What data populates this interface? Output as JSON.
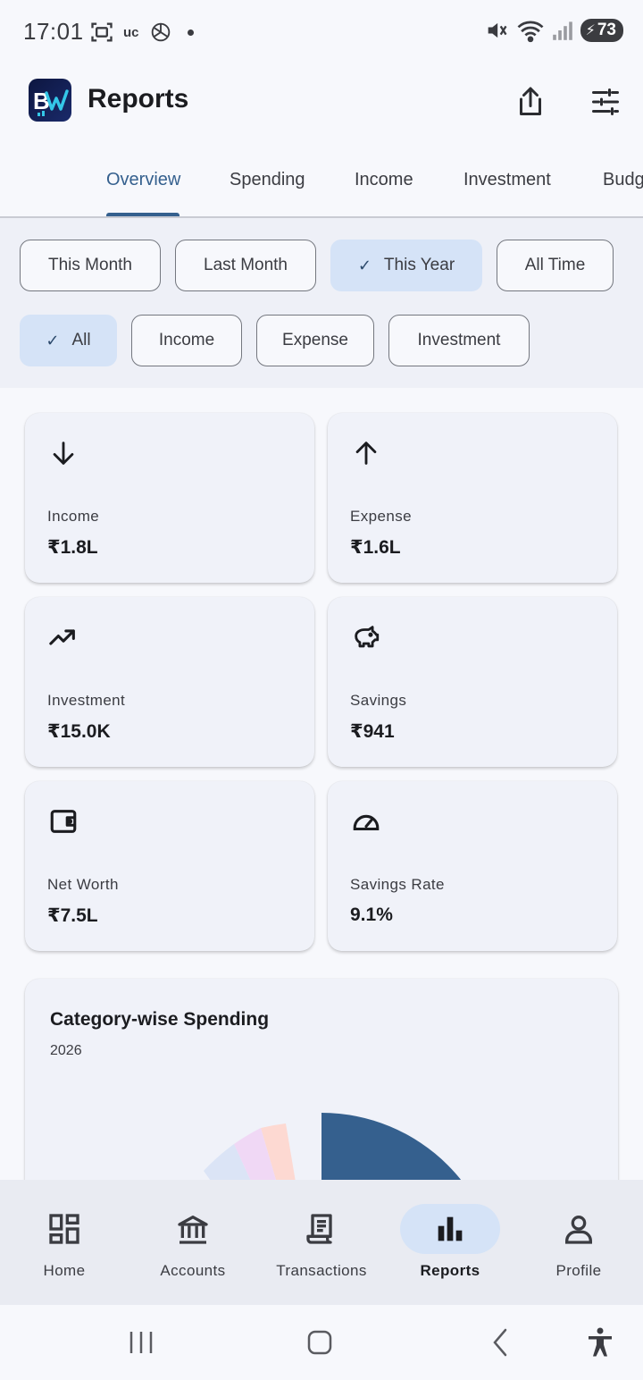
{
  "status": {
    "time": "17:01",
    "battery": "73",
    "left_badge": "uc"
  },
  "appbar": {
    "title": "Reports",
    "logo_text": "BW"
  },
  "tabs": [
    "Overview",
    "Spending",
    "Income",
    "Investment",
    "Budg"
  ],
  "period_chips": [
    {
      "label": "This Month",
      "selected": false
    },
    {
      "label": "Last Month",
      "selected": false
    },
    {
      "label": "This Year",
      "selected": true
    },
    {
      "label": "All Time",
      "selected": false
    }
  ],
  "type_chips": [
    {
      "label": "All",
      "selected": true
    },
    {
      "label": "Income",
      "selected": false
    },
    {
      "label": "Expense",
      "selected": false
    },
    {
      "label": "Investment",
      "selected": false
    }
  ],
  "cards": [
    {
      "label": "Income",
      "value": "₹1.8L",
      "icon": "arrow-down-icon"
    },
    {
      "label": "Expense",
      "value": "₹1.6L",
      "icon": "arrow-up-icon"
    },
    {
      "label": "Investment",
      "value": "₹15.0K",
      "icon": "trending-up-icon"
    },
    {
      "label": "Savings",
      "value": "₹941",
      "icon": "piggy-bank-icon"
    },
    {
      "label": "Net Worth",
      "value": "₹7.5L",
      "icon": "wallet-icon"
    },
    {
      "label": "Savings Rate",
      "value": "9.1%",
      "icon": "speedometer-icon"
    }
  ],
  "chart": {
    "title": "Category-wise Spending",
    "subtitle": "2026"
  },
  "colors": {
    "accent": "#35608e",
    "chip_selected": "#d5e3f7",
    "slice_main": "#35608e",
    "slice_pink": "#fdd9d2",
    "slice_lilac": "#f0d8f5",
    "slice_blue": "#dbe4f6"
  },
  "nav": [
    {
      "label": "Home",
      "icon": "dashboard-icon",
      "active": false
    },
    {
      "label": "Accounts",
      "icon": "bank-icon",
      "active": false
    },
    {
      "label": "Transactions",
      "icon": "receipt-icon",
      "active": false
    },
    {
      "label": "Reports",
      "icon": "bar-chart-icon",
      "active": true
    },
    {
      "label": "Profile",
      "icon": "person-icon",
      "active": false
    }
  ]
}
